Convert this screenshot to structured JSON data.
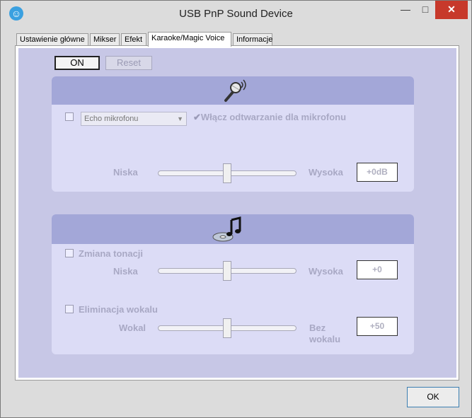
{
  "window": {
    "title": "USB PnP Sound Device",
    "app_icon_glyph": "☺"
  },
  "title_buttons": {
    "minimize": "—",
    "maximize": "□",
    "close": "✕"
  },
  "tabs": [
    {
      "label": "Ustawienie główne",
      "active": false
    },
    {
      "label": "Mikser",
      "active": false
    },
    {
      "label": "Efekt",
      "active": false
    },
    {
      "label": "Karaoke/Magic Voice",
      "active": true
    },
    {
      "label": "Informacje",
      "active": false
    }
  ],
  "controls": {
    "on_label": "ON",
    "reset_label": "Reset"
  },
  "mic": {
    "echo_select_value": "Echo mikrofonu",
    "playback_label": "Włącz odtwarzanie dla mikrofonu",
    "slider_low_label": "Niska",
    "slider_high_label": "Wysoka",
    "value": "+0dB",
    "slider_level": 0.5
  },
  "music": {
    "pitch_label": "Zmiana tonacji",
    "pitch_low_label": "Niska",
    "pitch_high_label": "Wysoka",
    "pitch_value": "+0",
    "pitch_level": 0.5,
    "vocal_label": "Eliminacja wokalu",
    "vocal_low_label": "Wokal",
    "vocal_high_label_1": "Bez",
    "vocal_high_label_2": "wokalu",
    "vocal_value": "+50",
    "vocal_level": 0.5
  },
  "footer": {
    "ok_label": "OK"
  },
  "icons": {
    "mic_icon": "microphone-icon",
    "music_icon": "music-disc-icon"
  }
}
